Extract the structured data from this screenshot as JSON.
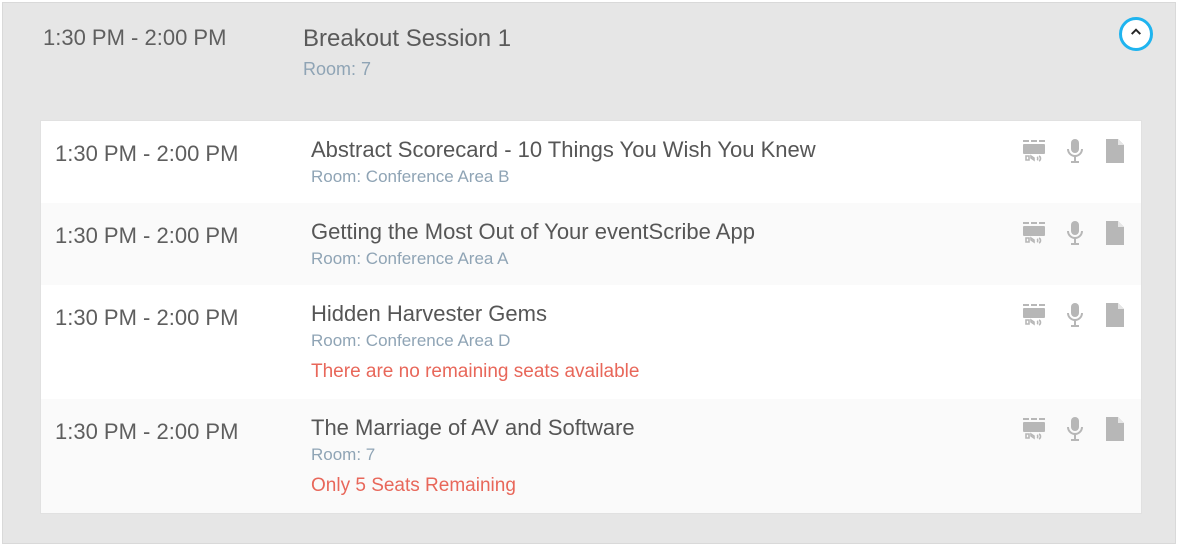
{
  "parent": {
    "time": "1:30 PM - 2:00 PM",
    "title": "Breakout Session 1",
    "room": "Room: 7"
  },
  "sessions": [
    {
      "time": "1:30 PM - 2:00 PM",
      "title": "Abstract Scorecard - 10 Things You Wish You Knew",
      "room": "Room: Conference Area B",
      "warning": ""
    },
    {
      "time": "1:30 PM - 2:00 PM",
      "title": "Getting the Most Out of Your eventScribe App",
      "room": "Room: Conference Area A",
      "warning": ""
    },
    {
      "time": "1:30 PM - 2:00 PM",
      "title": "Hidden Harvester Gems",
      "room": "Room: Conference Area D",
      "warning": "There are no remaining seats available"
    },
    {
      "time": "1:30 PM - 2:00 PM",
      "title": "The Marriage of AV and Software",
      "room": "Room: 7",
      "warning": "Only 5 Seats Remaining"
    }
  ]
}
